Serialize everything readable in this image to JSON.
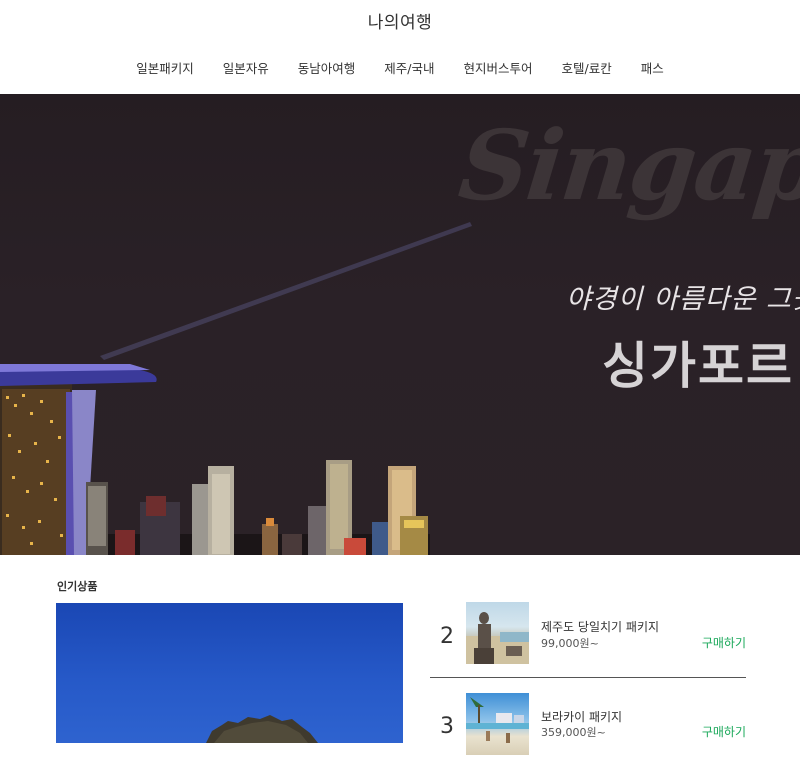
{
  "header": {
    "site_title": "나의여행"
  },
  "nav": {
    "items": [
      "일본패키지",
      "일본자유",
      "동남아여행",
      "제주/국내",
      "현지버스투어",
      "호텔/료칸",
      "패스"
    ]
  },
  "hero": {
    "watermark": "Singapore",
    "subtitle": "야경이 아름다운 그곳",
    "title": "싱가포르"
  },
  "popular": {
    "section_label": "인기상품",
    "products": [
      {
        "rank": "2",
        "name": "제주도 당일치기 패키지",
        "price": "99,000원~",
        "buy_label": "구매하기",
        "thumb_icon": "jeju-statue-photo"
      },
      {
        "rank": "3",
        "name": "보라카이 패키지",
        "price": "359,000원~",
        "buy_label": "구매하기",
        "thumb_icon": "boracay-beach-photo"
      }
    ]
  },
  "colors": {
    "buy_accent": "#1aa85a",
    "hero_bg": "#2a2127"
  }
}
